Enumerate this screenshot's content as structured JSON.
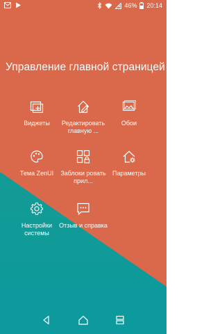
{
  "status_bar": {
    "icons_left": [
      "mail-icon",
      "play-icon"
    ],
    "icons_right": [
      "bluetooth-icon",
      "wifi-icon",
      "no-sim-icon",
      "battery-icon"
    ],
    "battery": "46%",
    "time": "20:14"
  },
  "page_title": "Управление главной страницей",
  "tiles": [
    {
      "label": "Виджеты",
      "icon": "widgets-icon"
    },
    {
      "label": "Редактировать главную ...",
      "icon": "edit-home-icon"
    },
    {
      "label": "Обои",
      "icon": "wallpaper-icon"
    },
    {
      "label": "Тема ZenUI",
      "icon": "palette-icon"
    },
    {
      "label": "Заблоки ровать прил...",
      "icon": "app-lock-icon"
    },
    {
      "label": "Параметры",
      "icon": "home-settings-icon"
    },
    {
      "label": "Настройки системы",
      "icon": "gear-icon"
    },
    {
      "label": "Отзыв и справка",
      "icon": "feedback-icon"
    }
  ],
  "nav_bar": {
    "buttons": [
      "back-icon",
      "home-icon",
      "recents-icon"
    ]
  },
  "colors": {
    "background_top": "#d9694a",
    "background_bottom": "#139b95",
    "text": "#ffffff"
  }
}
